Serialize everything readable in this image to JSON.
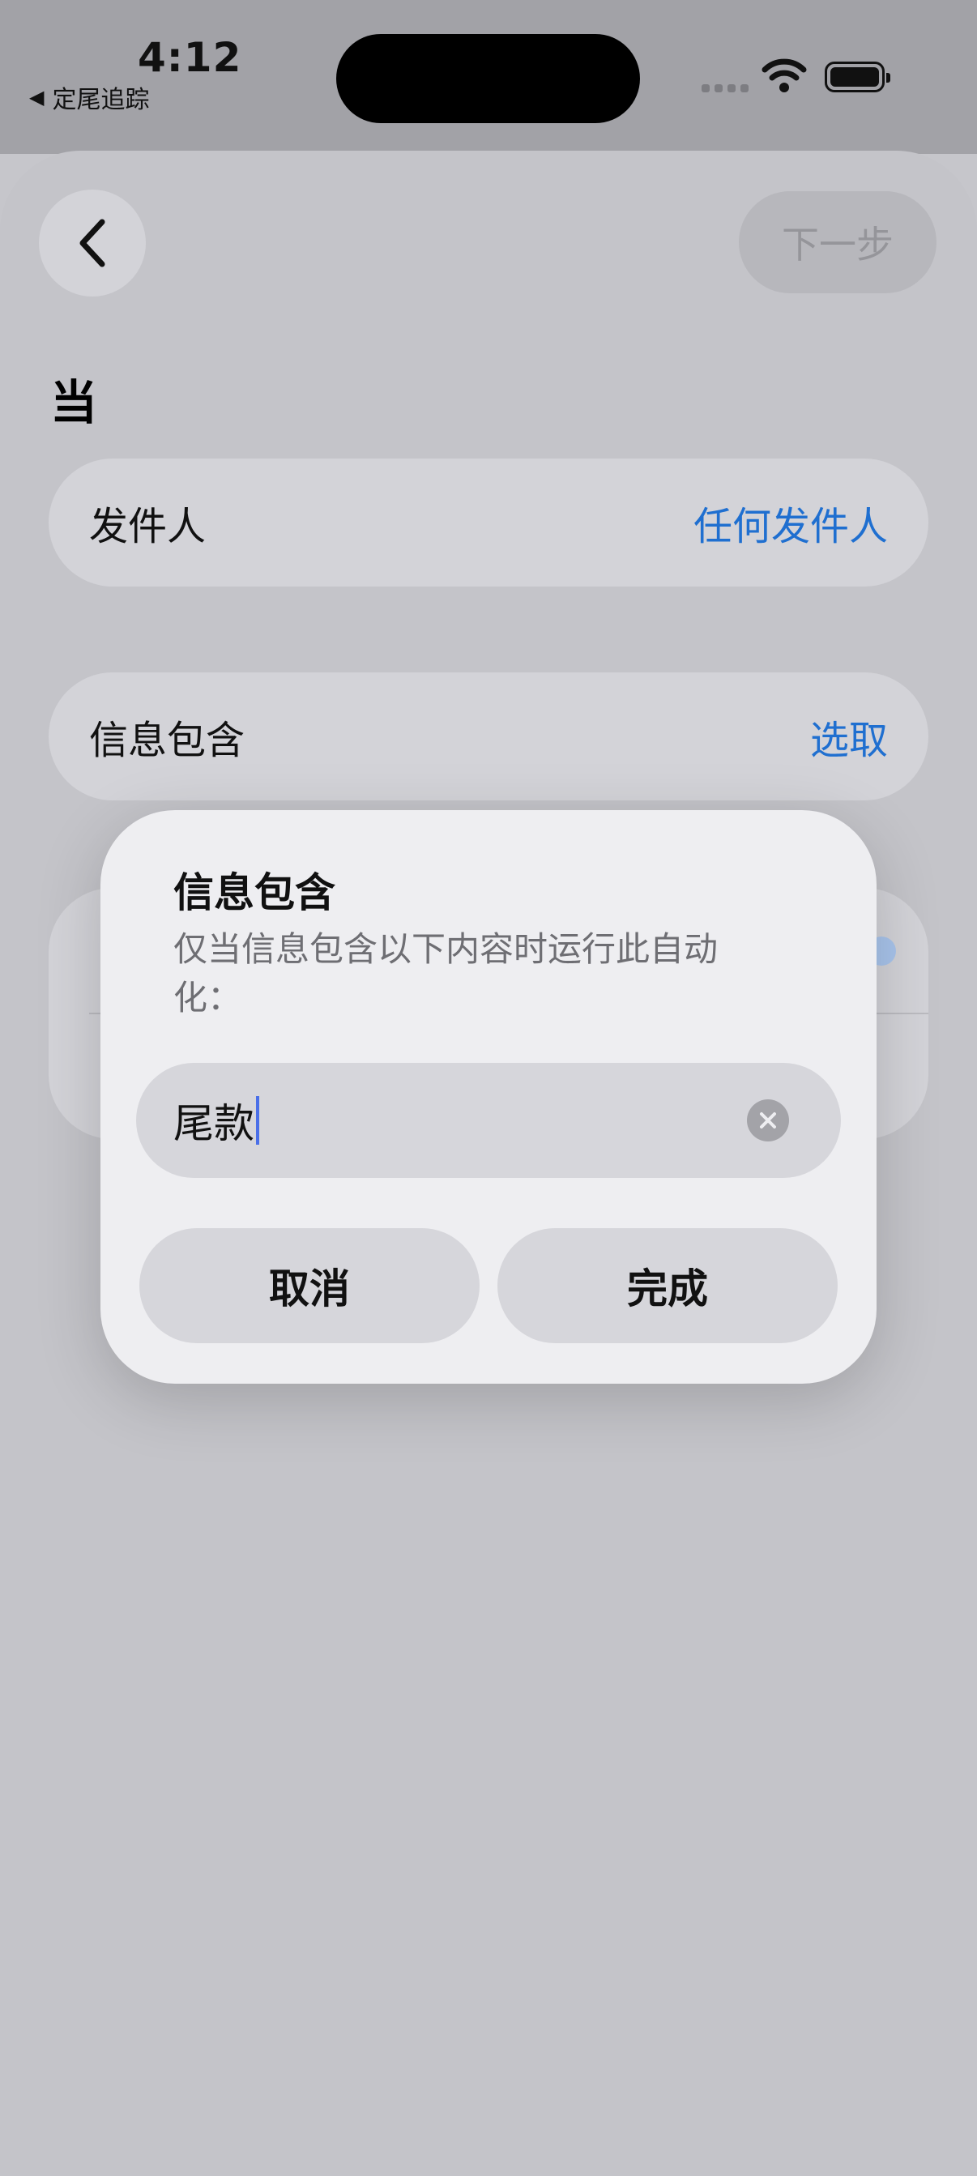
{
  "status_bar": {
    "time": "4:12",
    "back_app": "定尾追踪",
    "icons": [
      "signal-icon",
      "wifi-icon",
      "battery-icon"
    ]
  },
  "nav": {
    "back_icon": "chevron-left-icon",
    "next_label": "下一步"
  },
  "section_title": "当",
  "sender_row": {
    "label": "发件人",
    "value": "任何发件人"
  },
  "message_row": {
    "label": "信息包含",
    "value": "选取"
  },
  "dialog": {
    "title": "信息包含",
    "description": "仅当信息包含以下内容时运行此自动化：",
    "input_value": "尾款",
    "clear_icon": "clear-circle-icon",
    "cancel_label": "取消",
    "done_label": "完成"
  },
  "colors": {
    "accent_link": "#1f6fd0",
    "caret": "#4a6fe8",
    "background": "#c6c6cb"
  }
}
